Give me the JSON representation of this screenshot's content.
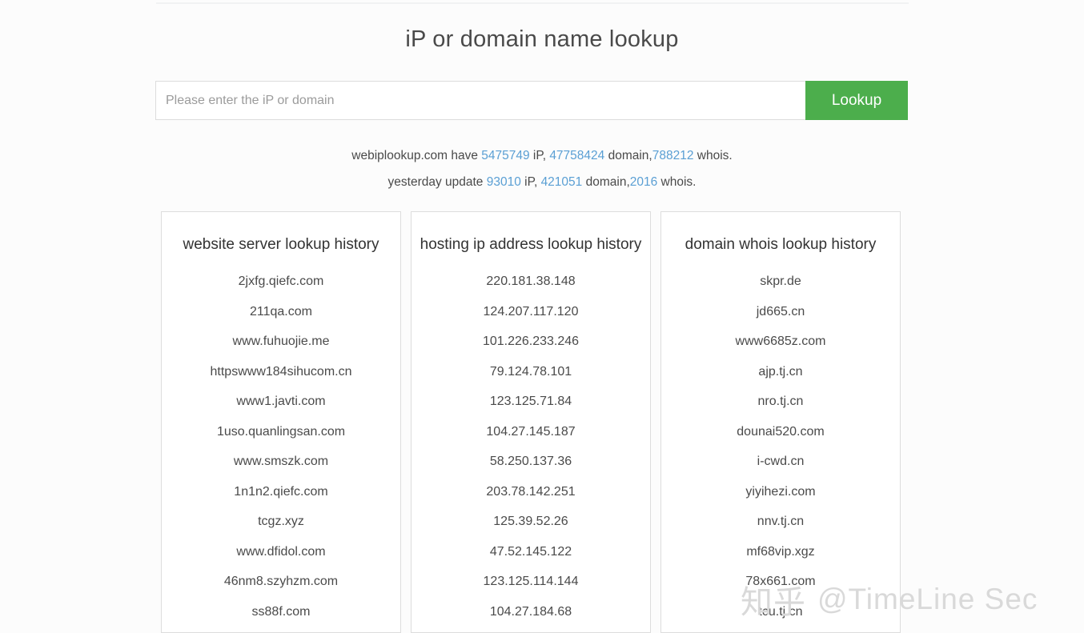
{
  "page": {
    "title": "iP or domain name lookup"
  },
  "search": {
    "placeholder": "Please enter the iP or domain",
    "value": "",
    "button_label": "Lookup"
  },
  "stats": {
    "line1": {
      "site": "webiplookup.com have",
      "ip_count": "5475749",
      "ip_word": " iP, ",
      "domain_count": "47758424",
      "domain_word": " domain,",
      "whois_count": "788212",
      "whois_word": " whois."
    },
    "line2": {
      "prefix": "yesterday update",
      "ip_count": "93010",
      "ip_word": " iP, ",
      "domain_count": "421051",
      "domain_word": " domain,",
      "whois_count": "2016",
      "whois_word": " whois."
    }
  },
  "panels": [
    {
      "title": "website server lookup history",
      "items": [
        "2jxfg.qiefc.com",
        "211qa.com",
        "www.fuhuojie.me",
        "httpswww184sihucom.cn",
        "www1.javti.com",
        "1uso.quanlingsan.com",
        "www.smszk.com",
        "1n1n2.qiefc.com",
        "tcgz.xyz",
        "www.dfidol.com",
        "46nm8.szyhzm.com",
        "ss88f.com"
      ]
    },
    {
      "title": "hosting ip address lookup history",
      "items": [
        "220.181.38.148",
        "124.207.117.120",
        "101.226.233.246",
        "79.124.78.101",
        "123.125.71.84",
        "104.27.145.187",
        "58.250.137.36",
        "203.78.142.251",
        "125.39.52.26",
        "47.52.145.122",
        "123.125.114.144",
        "104.27.184.68"
      ]
    },
    {
      "title": "domain whois lookup history",
      "items": [
        "skpr.de",
        "jd665.cn",
        "www6685z.com",
        "ajp.tj.cn",
        "nro.tj.cn",
        "dounai520.com",
        "i-cwd.cn",
        "yiyihezi.com",
        "nnv.tj.cn",
        "mf68vip.xgz",
        "78x661.com",
        "tcu.tj.cn"
      ]
    }
  ],
  "watermark": {
    "cn": "知乎",
    "en": "@TimeLine Sec"
  },
  "colors": {
    "button_green": "#4cae4c",
    "link_blue": "#5a9fd4",
    "text": "#4a4a4a",
    "border": "#dddddd",
    "watermark": "#d9d9d9"
  }
}
